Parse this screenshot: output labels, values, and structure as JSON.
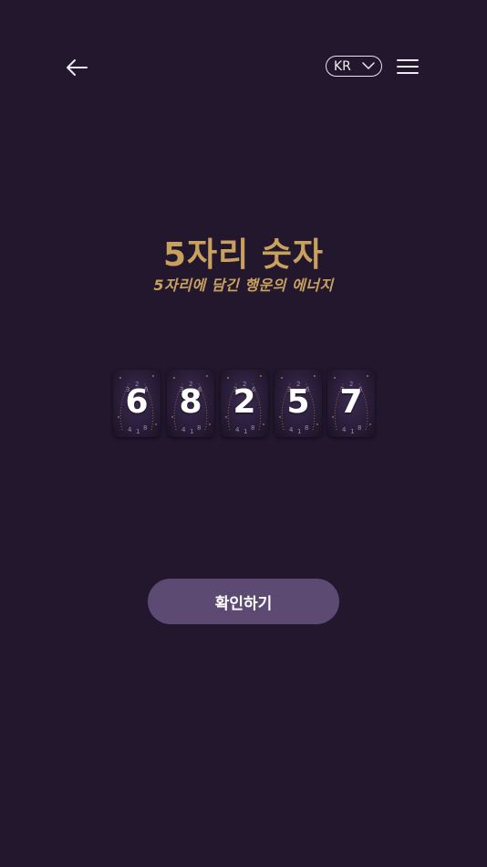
{
  "header": {
    "back_icon": "arrow-left-icon",
    "language": {
      "selected": "KR",
      "icon": "chevron-down-icon"
    },
    "menu_icon": "hamburger-menu-icon"
  },
  "main": {
    "title": "5자리 숫자",
    "subtitle": "5자리에 담긴 행운의 에너지",
    "cards": [
      {
        "digit": "6"
      },
      {
        "digit": "8"
      },
      {
        "digit": "2"
      },
      {
        "digit": "5"
      },
      {
        "digit": "7"
      }
    ],
    "confirm_label": "확인하기"
  },
  "colors": {
    "background": "#22172d",
    "accent_gold": "#c8a15f",
    "button": "#5d4a72"
  }
}
